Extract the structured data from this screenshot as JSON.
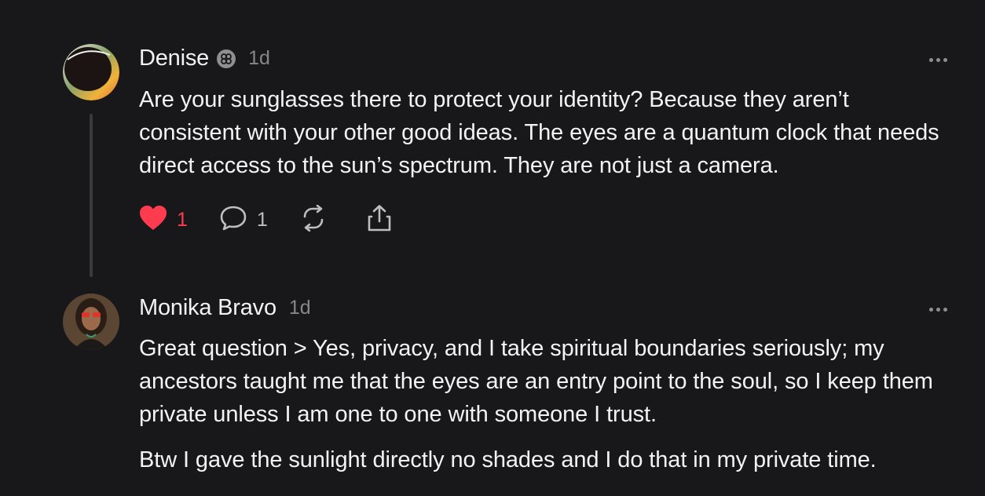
{
  "posts": [
    {
      "username": "Denise",
      "badge_icon": "verified-flower-icon",
      "time": "1d",
      "body": "Are your sunglasses there to protect your identity? Because they aren’t consistent with your other good ideas. The eyes are a quantum clock that needs direct access to the sun’s spectrum. They are not just a camera.",
      "actions": {
        "likes": "1",
        "comments": "1"
      }
    },
    {
      "username": "Monika Bravo",
      "time": "1d",
      "body": "Great question > Yes, privacy, and I take spiritual boundaries seriously; my ancestors taught me that the eyes are an entry point to the soul, so I keep them private unless I am one to one with someone I trust.",
      "body2": "Btw I gave the sunlight directly no shades and I do that in my private time."
    }
  ],
  "colors": {
    "background": "#18181a",
    "text": "#f3f3f5",
    "muted": "#86868b",
    "like": "#ff3b4f",
    "thread_line": "#3a3a3d"
  }
}
